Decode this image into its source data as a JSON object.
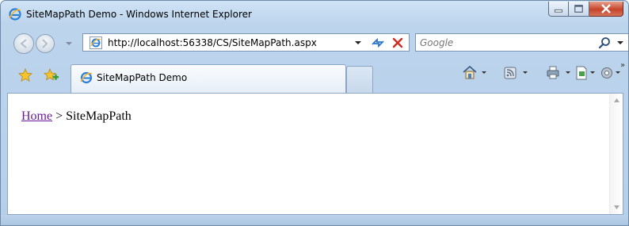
{
  "window": {
    "title": "SiteMapPath Demo - Windows Internet Explorer"
  },
  "address_bar": {
    "url": "http://localhost:56338/CS/SiteMapPath.aspx"
  },
  "search": {
    "placeholder": "Google"
  },
  "tab": {
    "label": "SiteMapPath Demo"
  },
  "page": {
    "breadcrumb": {
      "home_link": "Home",
      "separator": " > ",
      "current": "SiteMapPath"
    }
  },
  "colors": {
    "link": "#6a1b9a",
    "window_frame": "#bcd4ec",
    "close_button": "#c4452b"
  }
}
